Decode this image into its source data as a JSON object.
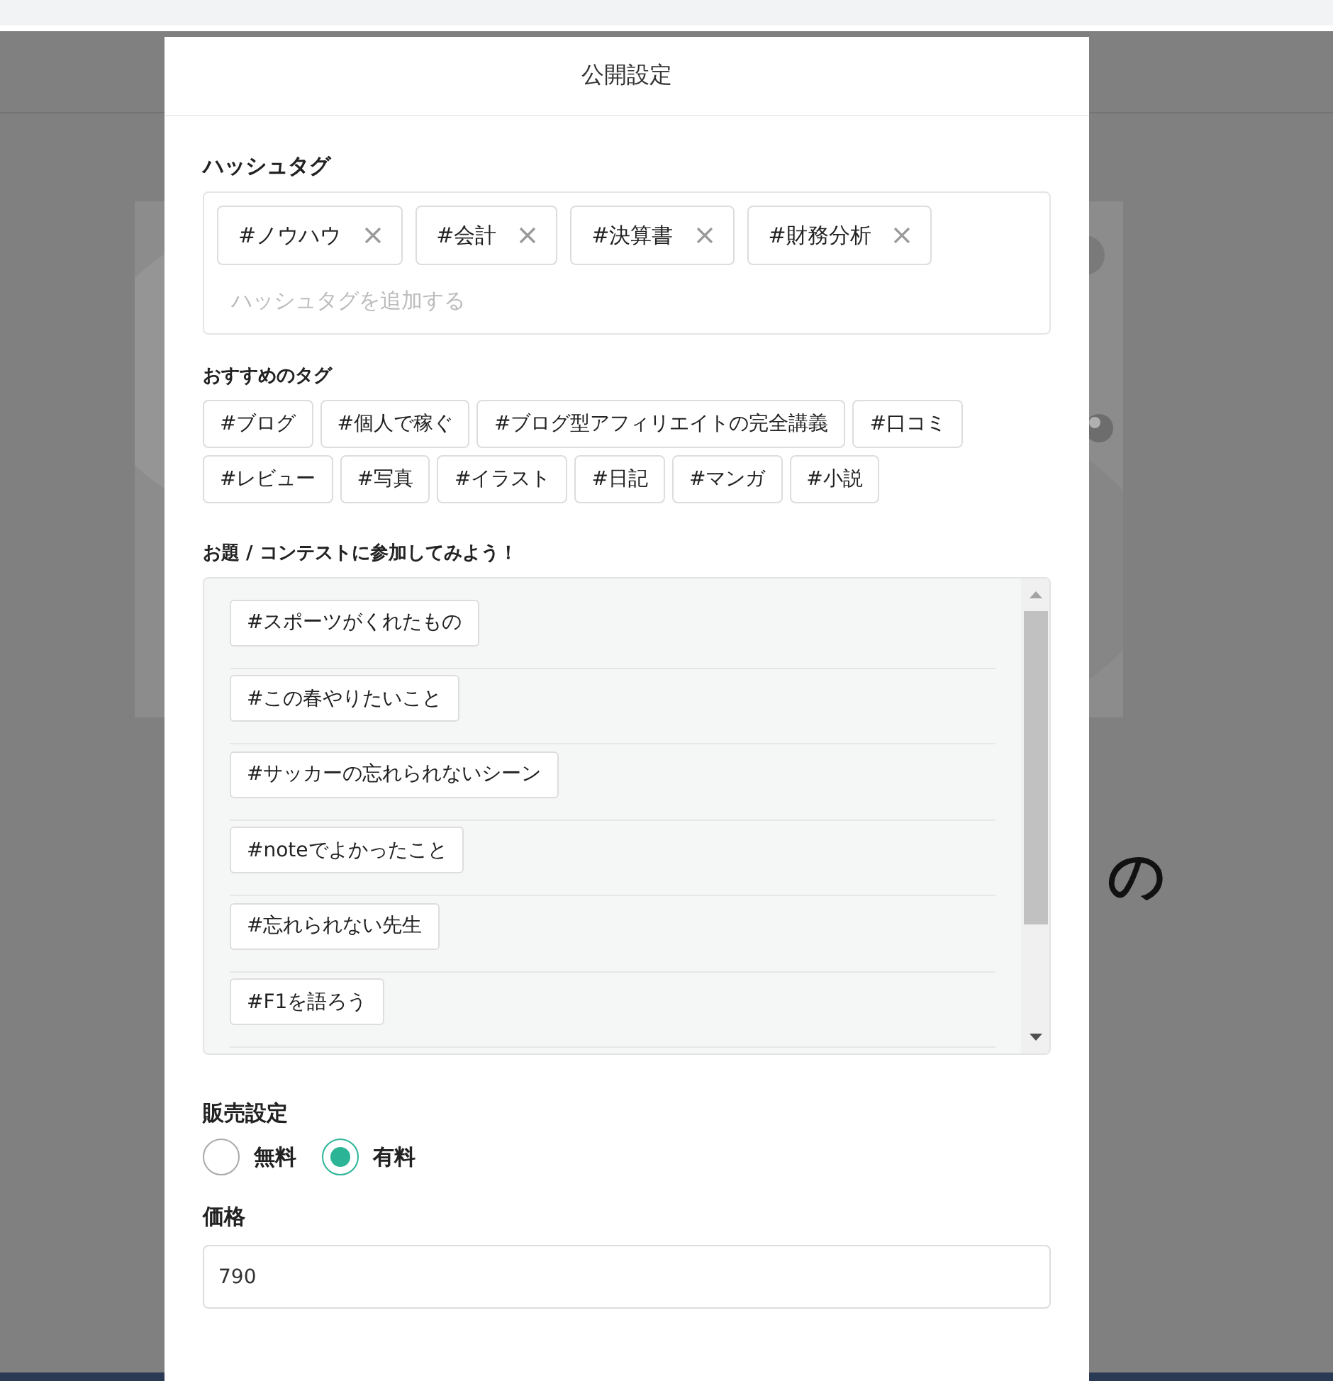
{
  "background": {
    "heading_right": "の"
  },
  "dialog": {
    "title": "公開設定"
  },
  "hashtags": {
    "label": "ハッシュタグ",
    "tags": [
      "#ノウハウ",
      "#会計",
      "#決算書",
      "#財務分析"
    ],
    "placeholder": "ハッシュタグを追加する"
  },
  "recommended": {
    "label": "おすすめのタグ",
    "tags": [
      "#ブログ",
      "#個人で稼ぐ",
      "#ブログ型アフィリエイトの完全講義",
      "#口コミ",
      "#レビュー",
      "#写真",
      "#イラスト",
      "#日記",
      "#マンガ",
      "#小説"
    ]
  },
  "contests": {
    "label": "お題 / コンテストに参加してみよう！",
    "tags": [
      "#スポーツがくれたもの",
      "#この春やりたいこと",
      "#サッカーの忘れられないシーン",
      "#noteでよかったこと",
      "#忘れられない先生",
      "#F1を語ろう"
    ]
  },
  "sales": {
    "label": "販売設定",
    "options": [
      {
        "label": "無料",
        "selected": false
      },
      {
        "label": "有料",
        "selected": true
      }
    ]
  },
  "price": {
    "label": "価格",
    "value": "790"
  }
}
